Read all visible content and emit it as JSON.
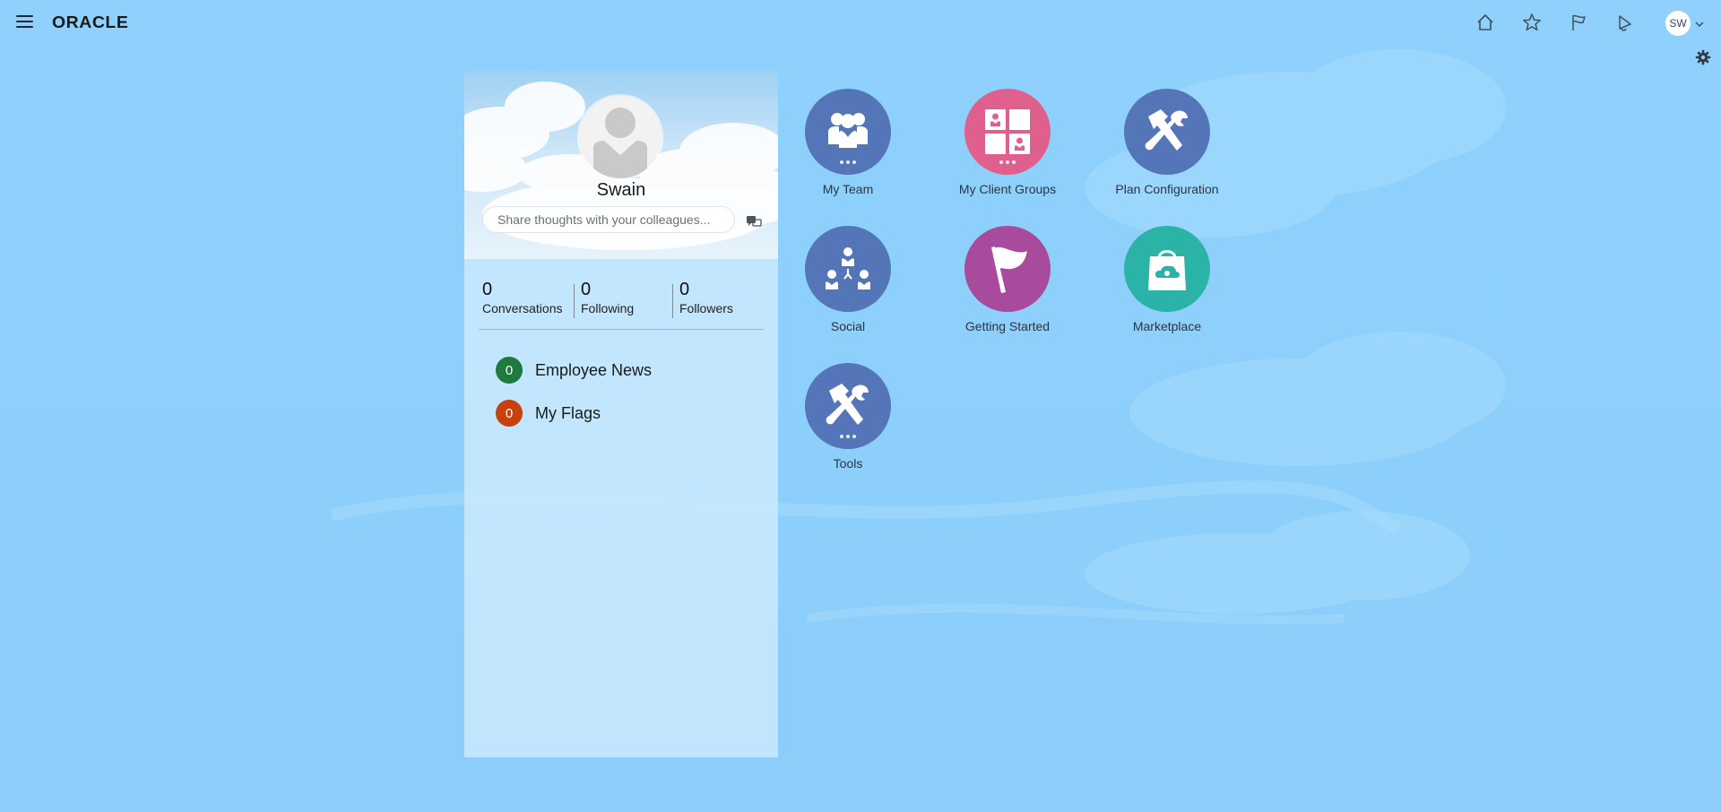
{
  "header": {
    "menu_label": "Navigator",
    "logo": "ORACLE",
    "icons": [
      "home-icon",
      "favorites-star-icon",
      "watchlist-flag-icon",
      "notifications-bell-icon"
    ],
    "user_initials": "SW"
  },
  "profile": {
    "name": "Swain",
    "share_placeholder": "Share thoughts with your colleagues...",
    "stats": [
      {
        "value": "0",
        "label": "Conversations"
      },
      {
        "value": "0",
        "label": "Following"
      },
      {
        "value": "0",
        "label": "Followers"
      }
    ],
    "watchlist": [
      {
        "count": "0",
        "label": "Employee News",
        "color": "#1e7a3e"
      },
      {
        "count": "0",
        "label": "My Flags",
        "color": "#c8410c"
      }
    ]
  },
  "tiles": [
    {
      "label": "My Team",
      "icon": "team-icon",
      "color": "#5476b9",
      "has_more": true
    },
    {
      "label": "My Client Groups",
      "icon": "client-groups-icon",
      "color": "#e0608d",
      "has_more": true
    },
    {
      "label": "Plan Configuration",
      "icon": "tools-icon",
      "color": "#5476b9",
      "has_more": false
    },
    {
      "label": "Social",
      "icon": "social-icon",
      "color": "#5476b9",
      "has_more": false
    },
    {
      "label": "Getting Started",
      "icon": "flag-icon",
      "color": "#a84b9d",
      "has_more": false
    },
    {
      "label": "Marketplace",
      "icon": "marketplace-bag-icon",
      "color": "#2cb3a8",
      "has_more": false
    },
    {
      "label": "Tools",
      "icon": "tools-icon",
      "color": "#5476b9",
      "has_more": true
    }
  ]
}
